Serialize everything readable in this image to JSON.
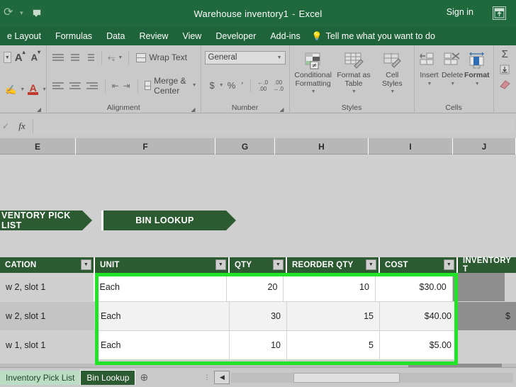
{
  "titlebar": {
    "document_name": "Warehouse inventory1",
    "app_name": "Excel",
    "separator": "-",
    "signin_label": "Sign in",
    "redo_icon": "redo-icon",
    "qat_customize_icon": "customize-quick-access-toolbar-icon",
    "ribbon_display_icon": "ribbon-display-options-icon",
    "accent_color": "#20693d"
  },
  "ribbon_tabs": [
    {
      "label": "e Layout"
    },
    {
      "label": "Formulas"
    },
    {
      "label": "Data"
    },
    {
      "label": "Review"
    },
    {
      "label": "View"
    },
    {
      "label": "Developer"
    },
    {
      "label": "Add-ins"
    }
  ],
  "tell_me": {
    "label": "Tell me what you want to do",
    "icon": "lightbulb-icon"
  },
  "ribbon": {
    "font_group": {
      "label": "",
      "grow_font_label": "A",
      "shrink_font_label": "A",
      "fill_color_icon": "fill-color-icon",
      "font_color_letter": "A",
      "font_color": "#c0392b"
    },
    "alignment_group": {
      "label": "Alignment",
      "wrap_text_label": "Wrap Text",
      "merge_center_label": "Merge & Center",
      "orientation_icon": "text-orientation-icon",
      "decrease_indent_icon": "decrease-indent-icon",
      "increase_indent_icon": "increase-indent-icon"
    },
    "number_group": {
      "label": "Number",
      "format_value": "General",
      "accounting_icon": "accounting-format-icon",
      "percent_icon": "percent-style-icon",
      "comma_icon": "comma-style-icon",
      "decrease_decimal_label": "←.0 .00",
      "increase_decimal_label": ".00 →.0"
    },
    "styles_group": {
      "label": "Styles",
      "items": [
        {
          "line1": "Conditional",
          "line2": "Formatting",
          "icon": "conditional-formatting-icon"
        },
        {
          "line1": "Format as",
          "line2": "Table",
          "icon": "format-as-table-icon"
        },
        {
          "line1": "Cell",
          "line2": "Styles",
          "icon": "cell-styles-icon"
        }
      ]
    },
    "cells_group": {
      "label": "Cells",
      "items": [
        {
          "line1": "Insert",
          "line2": "",
          "icon": "insert-cells-icon"
        },
        {
          "line1": "Delete",
          "line2": "",
          "icon": "delete-cells-icon"
        },
        {
          "line1": "Format",
          "line2": "",
          "icon": "format-cells-icon"
        }
      ]
    },
    "editing_group": {
      "autosum_icon": "autosum-icon",
      "fill_icon": "fill-down-icon",
      "clear_icon": "clear-eraser-icon"
    }
  },
  "formula_bar": {
    "enter_icon": "enter-check-icon",
    "fx_label": "fx",
    "value": "",
    "placeholder": ""
  },
  "column_headers": [
    "E",
    "F",
    "G",
    "H",
    "I",
    "J"
  ],
  "banner": {
    "tabs": [
      {
        "label": "VENTORY PICK LIST",
        "active": false
      },
      {
        "label": "BIN LOOKUP",
        "active": true
      }
    ],
    "color": "#2c5b32"
  },
  "table": {
    "headers": [
      {
        "label": "CATION",
        "filter_icon": "filter-dropdown-icon"
      },
      {
        "label": "UNIT",
        "filter_icon": "filter-dropdown-icon"
      },
      {
        "label": "QTY",
        "filter_icon": "filter-dropdown-icon"
      },
      {
        "label": "REORDER QTY",
        "filter_icon": "filter-dropdown-icon"
      },
      {
        "label": "COST",
        "filter_icon": "filter-dropdown-icon"
      },
      {
        "label": "INVENTORY T",
        "filter_icon": ""
      }
    ],
    "rows": [
      {
        "location": "w 2, slot 1",
        "unit": "Each",
        "qty": "20",
        "reorder_qty": "10",
        "cost": "$30.00",
        "inventory_value": ""
      },
      {
        "location": "w 2, slot 1",
        "unit": "Each",
        "qty": "30",
        "reorder_qty": "15",
        "cost": "$40.00",
        "inventory_value": "$"
      },
      {
        "location": "w 1, slot 1",
        "unit": "Each",
        "qty": "10",
        "reorder_qty": "5",
        "cost": "$5.00",
        "inventory_value": ""
      }
    ]
  },
  "highlight": {
    "color": "#21e428"
  },
  "sheet_bar": {
    "tabs": [
      {
        "label": "Inventory Pick List",
        "active": false
      },
      {
        "label": "Bin Lookup",
        "active": true
      }
    ],
    "add_sheet_icon": "add-sheet-icon",
    "tab_split_icon": "tab-split-handle-icon",
    "scroll_left_icon": "scroll-left-icon"
  }
}
